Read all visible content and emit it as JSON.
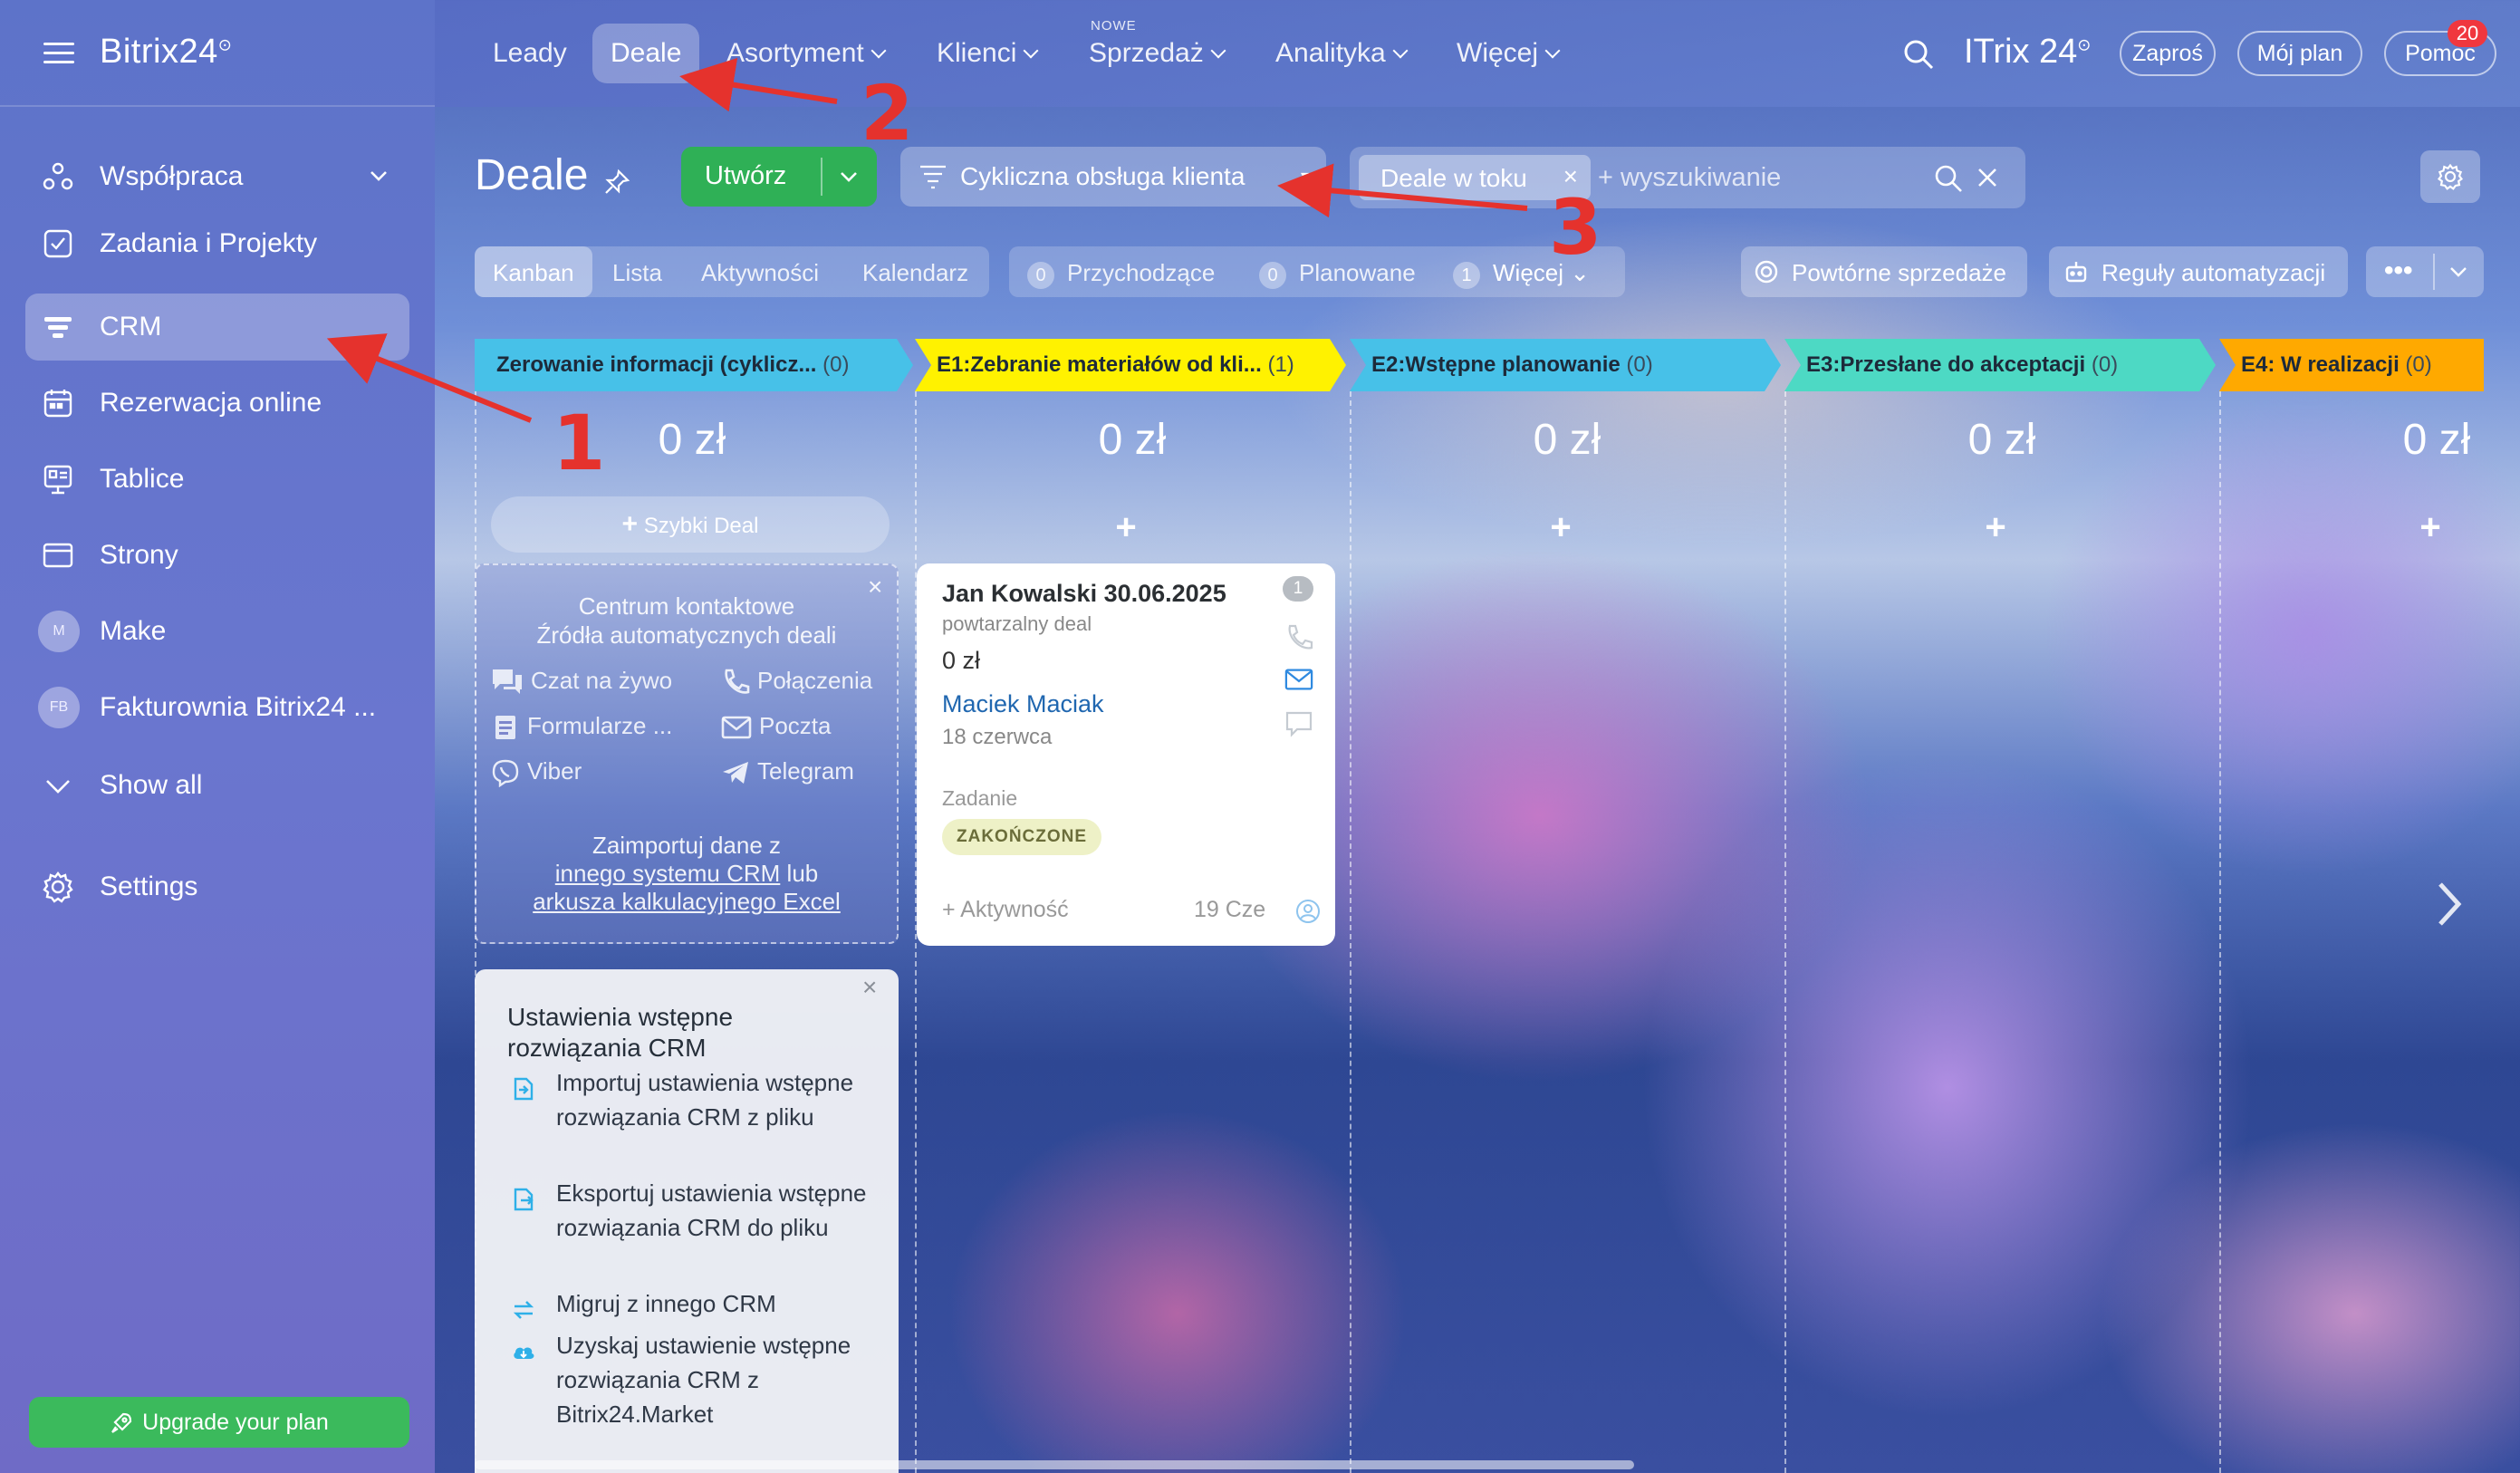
{
  "sidebar": {
    "logo": "Bitrix24",
    "items": [
      {
        "label": "Współpraca",
        "icon": "collaboration-icon",
        "has_chevron": true
      },
      {
        "label": "Zadania i Projekty",
        "icon": "task-checkbox-icon"
      },
      {
        "label": "CRM",
        "icon": "crm-filter-icon",
        "active": true
      },
      {
        "label": "Rezerwacja online",
        "icon": "calendar-icon"
      },
      {
        "label": "Tablice",
        "icon": "board-icon"
      },
      {
        "label": "Strony",
        "icon": "browser-window-icon"
      },
      {
        "label": "Make",
        "avatar": "M"
      },
      {
        "label": "Fakturownia Bitrix24 ...",
        "avatar": "FB"
      },
      {
        "label": "Show all",
        "icon": "chevron-down-icon"
      }
    ],
    "settings_label": "Settings",
    "upgrade_label": "Upgrade your plan"
  },
  "topnav": {
    "items": [
      {
        "label": "Leady",
        "chevron": false
      },
      {
        "label": "Deale",
        "chevron": false,
        "active": true
      },
      {
        "label": "Asortyment",
        "chevron": true
      },
      {
        "label": "Klienci",
        "chevron": true
      },
      {
        "label": "Sprzedaż",
        "chevron": true,
        "new": "NOWE"
      },
      {
        "label": "Analityka",
        "chevron": true
      },
      {
        "label": "Więcej",
        "chevron": true
      }
    ],
    "brand": "ITrix 24",
    "invite_label": "Zaproś",
    "plan_label": "Mój plan",
    "help_label": "Pomoc",
    "help_badge": "20"
  },
  "toolbar": {
    "title": "Deale",
    "create_label": "Utwórz",
    "pipeline_label": "Cykliczna obsługa klienta",
    "filter_chip": "Deale w toku",
    "search_placeholder": "+ wyszukiwanie"
  },
  "views": {
    "tabs": [
      "Kanban",
      "Lista",
      "Aktywności",
      "Kalendarz"
    ],
    "active": "Kanban",
    "counters": [
      {
        "count": "0",
        "label": "Przychodzące"
      },
      {
        "count": "0",
        "label": "Planowane"
      },
      {
        "count": "1",
        "label": "Więcej"
      }
    ],
    "repeat_sales": "Powtórne sprzedaże",
    "automation_rules": "Reguły automatyzacji",
    "more": "•••"
  },
  "kanban": {
    "columns": [
      {
        "name": "Zerowanie informacji (cyklicz...",
        "count": "(0)",
        "sum": "0 zł",
        "color": "#47c1e8"
      },
      {
        "name": "E1:Zebranie materiałów od kli...",
        "count": "(1)",
        "sum": "0 zł",
        "color": "#fff200"
      },
      {
        "name": "E2:Wstępne planowanie",
        "count": "(0)",
        "sum": "0 zł",
        "color": "#47c1e8"
      },
      {
        "name": "E3:Przesłane do akceptacji",
        "count": "(0)",
        "sum": "0 zł",
        "color": "#4dd9c4"
      },
      {
        "name": "E4: W realizacji",
        "count": "(0)",
        "sum": "0 zł",
        "color": "#ffa900"
      }
    ],
    "quick_deal": "Szybki Deal",
    "contact_center": {
      "title1": "Centrum kontaktowe",
      "title2": "Źródła automatycznych deali",
      "items": [
        "Czat na żywo",
        "Połączenia",
        "Formularze ...",
        "Poczta",
        "Viber",
        "Telegram"
      ],
      "import_line1": "Zaimportuj dane z",
      "import_link1": "innego systemu CRM",
      "import_mid": " lub",
      "import_link2": "arkusza kalkulacyjnego Excel"
    },
    "setup": {
      "title": "Ustawienia wstępne rozwiązania CRM",
      "items": [
        "Importuj ustawienia wstępne rozwiązania CRM z pliku",
        "Eksportuj ustawienia wstępne rozwiązania CRM do pliku",
        "Migruj z innego CRM",
        "Uzyskaj ustawienie wstępne rozwiązania CRM z Bitrix24.Market"
      ]
    },
    "deal": {
      "title": "Jan Kowalski 30.06.2025",
      "subtitle": "powtarzalny deal",
      "price": "0 zł",
      "contact": "Maciek Maciak",
      "date": "18 czerwca",
      "task_label": "Zadanie",
      "task_status": "ZAKOŃCZONE",
      "activity": "+ Aktywność",
      "activity_date": "19 Cze",
      "counter": "1"
    }
  },
  "annotations": [
    "1",
    "2",
    "3"
  ]
}
